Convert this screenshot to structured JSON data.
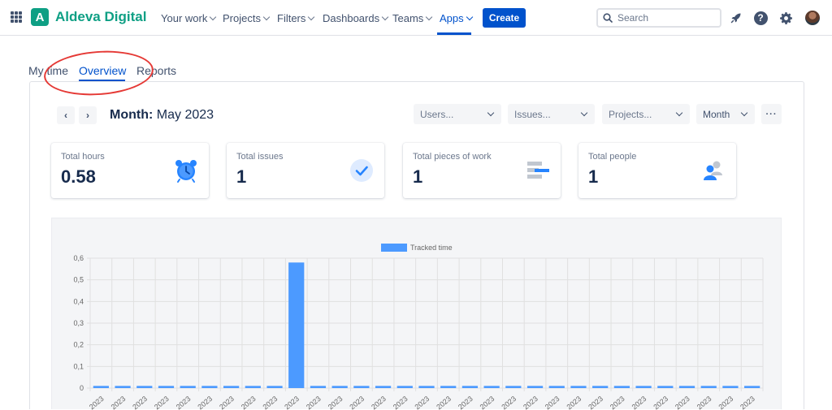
{
  "topnav": {
    "brand": "Aldeva Digital",
    "brand_letter": "A",
    "items": [
      {
        "label": "Your work"
      },
      {
        "label": "Projects"
      },
      {
        "label": "Filters"
      },
      {
        "label": "Dashboards"
      },
      {
        "label": "Teams"
      },
      {
        "label": "Apps",
        "active": true
      }
    ],
    "create_label": "Create",
    "search_placeholder": "Search",
    "accent_color": "#0052cc",
    "brand_color": "#0e9f84"
  },
  "tabs": [
    {
      "label": "My time"
    },
    {
      "label": "Overview",
      "active": true
    },
    {
      "label": "Reports"
    }
  ],
  "toolbar": {
    "prev_label": "‹",
    "next_label": "›",
    "month_prefix": "Month:",
    "month_value": "May 2023",
    "filters": [
      {
        "label": "Users..."
      },
      {
        "label": "Issues..."
      },
      {
        "label": "Projects..."
      },
      {
        "label": "Month"
      }
    ],
    "more_label": "···"
  },
  "stats": [
    {
      "label": "Total hours",
      "value": "0.58",
      "icon": "alarm-clock-icon"
    },
    {
      "label": "Total issues",
      "value": "1",
      "icon": "checkmark-circle-icon"
    },
    {
      "label": "Total pieces of work",
      "value": "1",
      "icon": "stacked-bars-icon"
    },
    {
      "label": "Total people",
      "value": "1",
      "icon": "people-icon"
    }
  ],
  "chart_data": {
    "type": "bar",
    "series": [
      {
        "name": "Tracked time",
        "color": "#4c9aff",
        "values": [
          0.01,
          0.01,
          0.01,
          0.01,
          0.01,
          0.01,
          0.01,
          0.01,
          0.01,
          0.58,
          0.01,
          0.01,
          0.01,
          0.01,
          0.01,
          0.01,
          0.01,
          0.01,
          0.01,
          0.01,
          0.01,
          0.01,
          0.01,
          0.01,
          0.01,
          0.01,
          0.01,
          0.01,
          0.01,
          0.01,
          0.01
        ]
      }
    ],
    "category_label": "2023",
    "yticks": [
      "0,6",
      "0,5",
      "0,4",
      "0,3",
      "0,2",
      "0,1",
      "0"
    ],
    "ylim": [
      0,
      0.6
    ],
    "grid": true,
    "legend": "top-center"
  },
  "annotation_color": "#e53935"
}
